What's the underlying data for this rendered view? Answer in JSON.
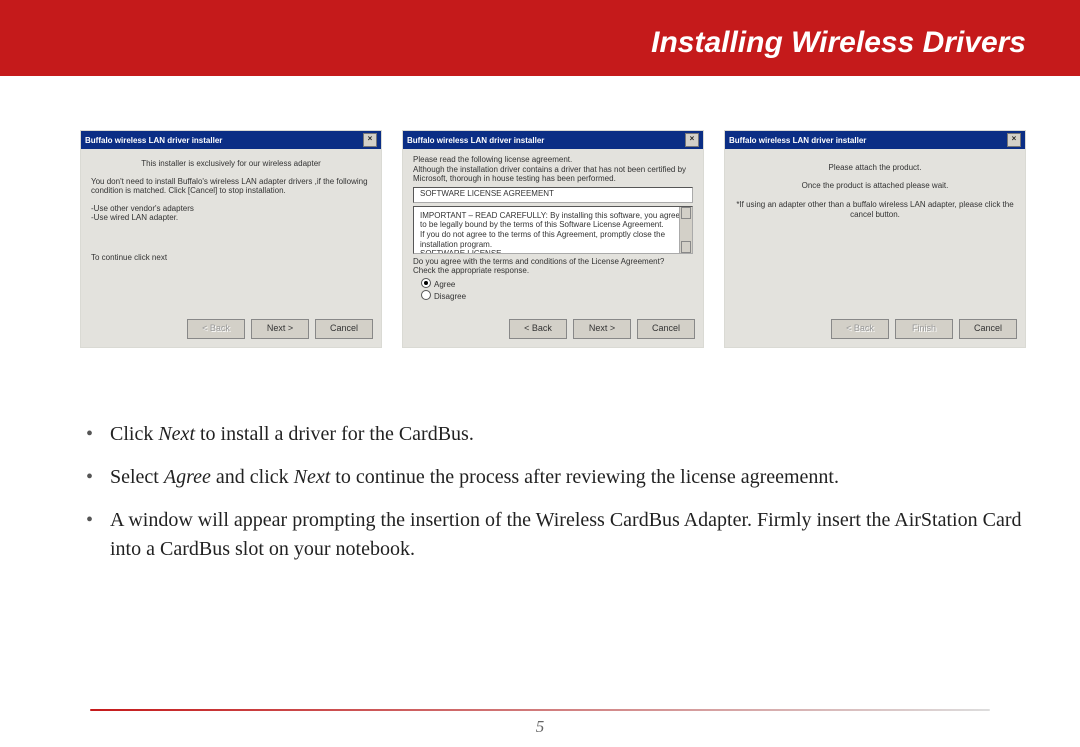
{
  "header": {
    "title": "Installing Wireless Drivers"
  },
  "dialogs": {
    "d1": {
      "titlebar": "Buffalo wireless LAN driver installer",
      "line1": "This installer is exclusively for our wireless adapter",
      "line2": "You don't need to install Buffalo's wireless LAN adapter drivers ,if the following condition is matched. Click [Cancel] to stop installation.",
      "line3": "-Use other vendor's adapters\n-Use wired LAN adapter.",
      "line4": "To continue click next",
      "buttons": {
        "back": "< Back",
        "next": "Next >",
        "cancel": "Cancel"
      }
    },
    "d2": {
      "titlebar": "Buffalo wireless LAN driver installer",
      "intro": "Please read the following license agreement.\nAlthough the installation driver contains a driver that has not been certified by Microsoft, thorough in house testing has been performed.",
      "box_header": "SOFTWARE LICENSE AGREEMENT",
      "box_body": "IMPORTANT – READ CAREFULLY: By installing this software, you agree to be legally bound by the terms of this Software License Agreement.\nIf you do not agree to the terms of this Agreement, promptly close the installation program.\nSOFTWARE LICENSE",
      "q": "Do you agree with the terms and conditions of the License Agreement?\nCheck the appropriate response.",
      "agree": "Agree",
      "disagree": "Disagree",
      "buttons": {
        "back": "< Back",
        "next": "Next >",
        "cancel": "Cancel"
      }
    },
    "d3": {
      "titlebar": "Buffalo wireless LAN driver installer",
      "line1": "Please attach the product.",
      "line2": "Once the product is attached please wait.",
      "line3": "*If using an adapter other than a buffalo wireless LAN adapter, please click the cancel button.",
      "buttons": {
        "back": "< Back",
        "finish": "Finish",
        "cancel": "Cancel"
      }
    }
  },
  "instructions": {
    "b1_a": "Click ",
    "b1_i": "Next",
    "b1_b": " to install a driver for the CardBus.",
    "b2_a": "Select ",
    "b2_i1": "Agree",
    "b2_b": " and click ",
    "b2_i2": "Next",
    "b2_c": " to continue the process after reviewing the license agreemennt.",
    "b3": "A window will appear prompting the insertion of the Wireless CardBus Adapter.  Firmly insert the AirStation Card into a CardBus slot on your notebook."
  },
  "page_number": "5"
}
